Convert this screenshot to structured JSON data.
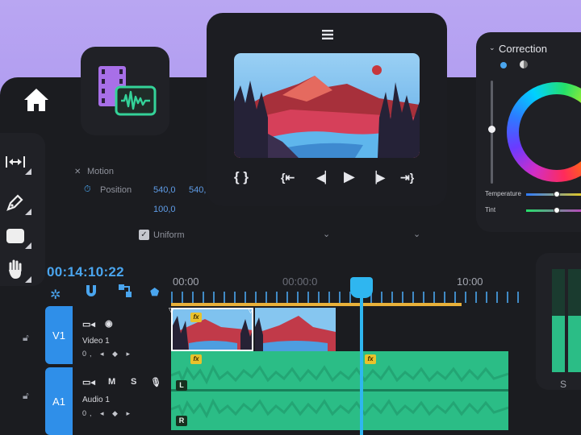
{
  "effect_controls": {
    "motion_label": "Motion",
    "position_label": "Position",
    "position_x": "540,0",
    "position_y": "540,",
    "scale_value": "100,0",
    "uniform_label": "Uniform"
  },
  "timeline": {
    "timecode": "00:14:10:22",
    "ruler_labels": [
      "00:00",
      "00:00:0",
      "10:00"
    ],
    "tracks": {
      "video": {
        "head": "V1",
        "name": "Video 1",
        "ctrl": "0, ◂ ◆ ▸"
      },
      "audio": {
        "head": "A1",
        "name": "Audio 1",
        "ctrl": "0, ◂ ◆ ▸",
        "m": "M",
        "s": "S"
      }
    },
    "fx_label": "fx",
    "left_channel": "L",
    "right_channel": "R"
  },
  "color": {
    "title": "Correction",
    "temperature_label": "Temperature",
    "tint_label": "Tint"
  },
  "meter": {
    "label": "S",
    "level_left": 0.55,
    "level_right": 0.55
  },
  "icons": {
    "home": "home-icon",
    "menu": "hamburger-icon",
    "media": "media-icon"
  },
  "colors": {
    "accent": "#4aa5ee",
    "audio_green": "#2bbd86",
    "fx_yellow": "#e9c22b",
    "panel": "#1d1e22"
  }
}
